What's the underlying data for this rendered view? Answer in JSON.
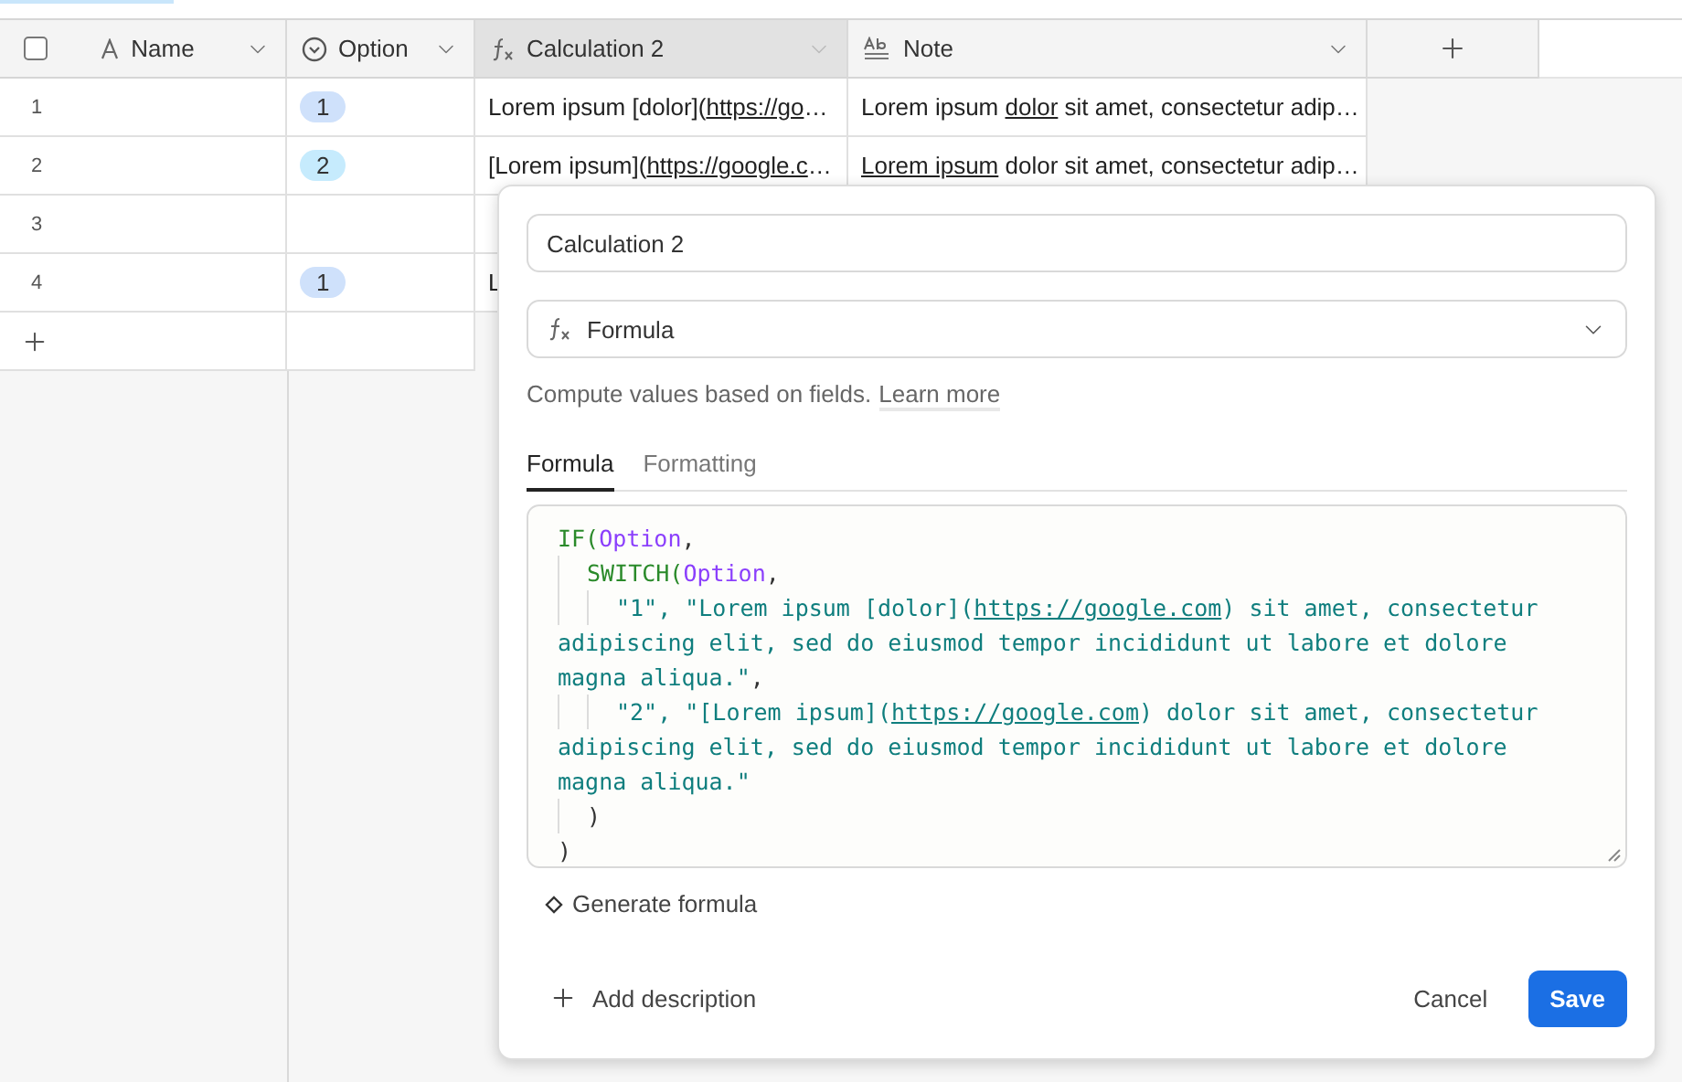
{
  "columns": [
    {
      "kind": "text",
      "label": "Name",
      "selected": false
    },
    {
      "kind": "select",
      "label": "Option",
      "selected": false
    },
    {
      "kind": "formula",
      "label": "Calculation 2",
      "selected": true
    },
    {
      "kind": "longtext",
      "label": "Note",
      "selected": false
    }
  ],
  "rows": [
    {
      "number": "1",
      "option": {
        "label": "1",
        "color": "#cfe1fb"
      },
      "calculation": [
        {
          "text": "Lorem ipsum [dolor]("
        },
        {
          "text": "https://go",
          "link": true
        },
        {
          "text": "…"
        }
      ],
      "note": [
        {
          "text": "Lorem ipsum "
        },
        {
          "text": "dolor",
          "link": true
        },
        {
          "text": " sit amet, consectetur adip…"
        }
      ]
    },
    {
      "number": "2",
      "option": {
        "label": "2",
        "color": "#c6ebfd"
      },
      "calculation": [
        {
          "text": "[Lorem ipsum]("
        },
        {
          "text": "https://google.c",
          "link": true
        },
        {
          "text": "…"
        }
      ],
      "note": [
        {
          "text": "Lorem ipsum",
          "link": true
        },
        {
          "text": " dolor sit amet, consectetur adip…"
        }
      ]
    },
    {
      "number": "3"
    },
    {
      "number": "4",
      "option": {
        "label": "1",
        "color": "#cfe1fb"
      },
      "calculation": [
        {
          "text": "L"
        }
      ]
    }
  ],
  "dialog": {
    "name": "Calculation 2",
    "type": "Formula",
    "help": "Compute values based on fields.",
    "help_link": "Learn more",
    "tabs": [
      {
        "label": "Formula",
        "selected": true
      },
      {
        "label": "Formatting",
        "selected": false
      }
    ],
    "code": [
      {
        "lines": [
          [
            {
              "kind": "func",
              "text": "IF("
            },
            {
              "kind": "field",
              "text": "Option"
            },
            {
              "kind": "punct",
              "text": ","
            }
          ]
        ],
        "children": [
          {
            "lines": [
              [
                {
                  "kind": "func",
                  "text": "SWITCH("
                },
                {
                  "kind": "field",
                  "text": "Option"
                },
                {
                  "kind": "punct",
                  "text": ","
                }
              ]
            ],
            "children": [
              {
                "lines": [
                  [
                    {
                      "kind": "string",
                      "text": "\"1\", \"Lorem ipsum [dolor]("
                    },
                    {
                      "kind": "link",
                      "text": "https://google.com"
                    },
                    {
                      "kind": "string",
                      "text": ") sit amet, consectetur"
                    }
                  ],
                  [
                    {
                      "kind": "string",
                      "text": "adipiscing elit, sed do eiusmod tempor incididunt ut labore et dolore"
                    }
                  ],
                  [
                    {
                      "kind": "string",
                      "text": "magna aliqua.\""
                    },
                    {
                      "kind": "punct",
                      "text": ","
                    }
                  ]
                ]
              },
              {
                "lines": [
                  [
                    {
                      "kind": "string",
                      "text": "\"2\", \"[Lorem ipsum]("
                    },
                    {
                      "kind": "link",
                      "text": "https://google.com"
                    },
                    {
                      "kind": "string",
                      "text": ") dolor sit amet, consectetur"
                    }
                  ],
                  [
                    {
                      "kind": "string",
                      "text": "adipiscing elit, sed do eiusmod tempor incididunt ut labore et dolore"
                    }
                  ],
                  [
                    {
                      "kind": "string",
                      "text": "magna aliqua.\""
                    }
                  ]
                ]
              }
            ]
          },
          {
            "lines": [
              [
                {
                  "kind": "punct",
                  "text": ")"
                }
              ]
            ]
          }
        ]
      },
      {
        "lines": [
          [
            {
              "kind": "punct",
              "text": ")"
            }
          ]
        ]
      }
    ],
    "generate": "Generate formula",
    "add_description": "Add description",
    "cancel": "Cancel",
    "save": "Save"
  }
}
